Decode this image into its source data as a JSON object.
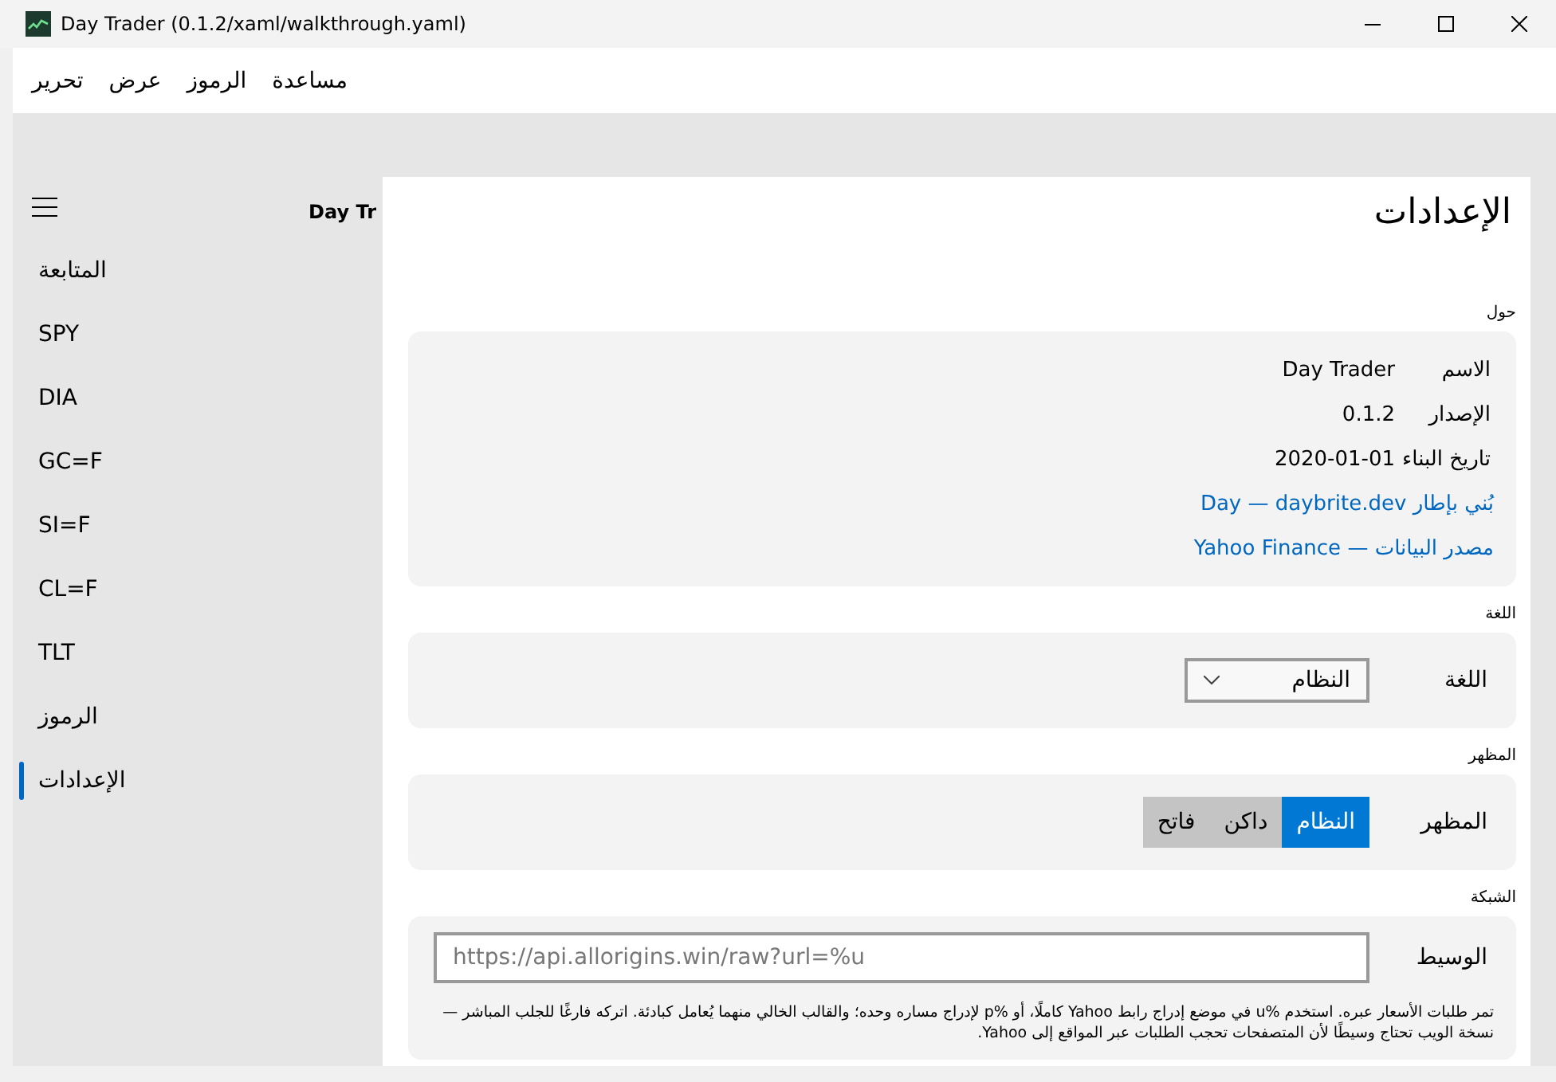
{
  "window": {
    "title": "Day Trader (0.1.2/xaml/walkthrough.yaml)"
  },
  "menu": [
    "مساعدة",
    "الرموز",
    "عرض",
    "تحرير"
  ],
  "nav": {
    "header": "Day Tr",
    "items": [
      {
        "label": "المتابعة",
        "selected": false
      },
      {
        "label": "SPY",
        "selected": false
      },
      {
        "label": "DIA",
        "selected": false
      },
      {
        "label": "GC=F",
        "selected": false
      },
      {
        "label": "SI=F",
        "selected": false
      },
      {
        "label": "CL=F",
        "selected": false
      },
      {
        "label": "TLT",
        "selected": false
      },
      {
        "label": "الرموز",
        "selected": false
      },
      {
        "label": "الإعدادات",
        "selected": true
      }
    ]
  },
  "page": {
    "title": "الإعدادات",
    "sections": [
      {
        "kind": "about",
        "header": "حول",
        "rows": [
          {
            "label": "الاسم",
            "value": "Day Trader"
          },
          {
            "label": "الإصدار",
            "value": "0.1.2"
          },
          {
            "label": "تاريخ البناء",
            "value": "2020-01-01"
          }
        ],
        "links": [
          "بُني بإطار Day — daybrite.dev",
          "مصدر البيانات — Yahoo Finance"
        ]
      },
      {
        "kind": "dropdown",
        "header": "اللغة",
        "label": "اللغة",
        "value": "النظام"
      },
      {
        "kind": "segmented",
        "header": "المظهر",
        "label": "المظهر",
        "options": [
          {
            "label": "النظام",
            "selected": true
          },
          {
            "label": "داكن",
            "selected": false
          },
          {
            "label": "فاتح",
            "selected": false
          }
        ]
      },
      {
        "kind": "input",
        "header": "الشبكة",
        "label": "الوسيط",
        "placeholder": "https://api.allorigins.win/raw?url=%u",
        "help": "تمر طلبات الأسعار عبره. استخدم %u في موضع إدراج رابط Yahoo كاملًا، أو %p لإدراج مساره وحده؛ والقالب الخالي منهما يُعامل كبادئة. اتركه فارغًا للجلب المباشر — نسخة الويب تحتاج وسيطًا لأن المتصفحات تحجب الطلبات عبر المواقع إلى Yahoo."
      }
    ]
  }
}
